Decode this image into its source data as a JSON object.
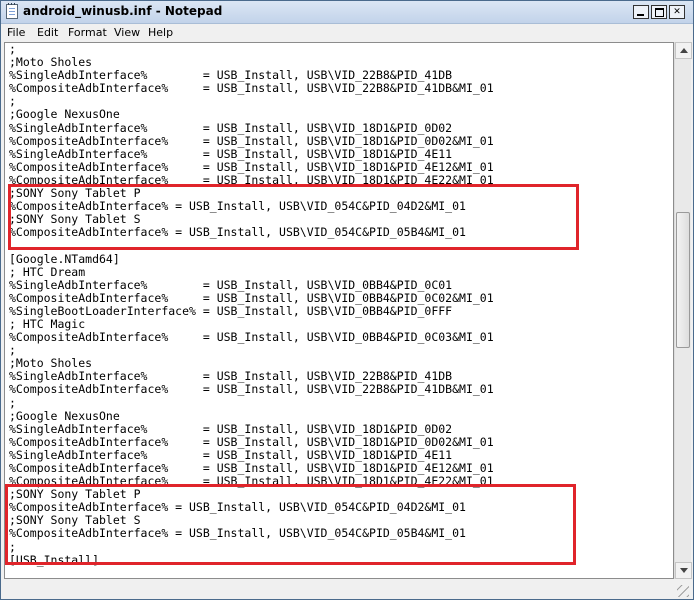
{
  "window": {
    "title": "android_winusb.inf - Notepad",
    "app_icon": "notepad-icon",
    "caption_buttons": [
      "minimize",
      "maximize",
      "close"
    ]
  },
  "menu": {
    "file": "File",
    "edit": "Edit",
    "format": "Format",
    "view": "View",
    "help": "Help"
  },
  "editor": {
    "lines": [
      ";",
      ";Moto Sholes",
      "%SingleAdbInterface%        = USB_Install, USB\\VID_22B8&PID_41DB",
      "%CompositeAdbInterface%     = USB_Install, USB\\VID_22B8&PID_41DB&MI_01",
      ";",
      ";Google NexusOne",
      "%SingleAdbInterface%        = USB_Install, USB\\VID_18D1&PID_0D02",
      "%CompositeAdbInterface%     = USB_Install, USB\\VID_18D1&PID_0D02&MI_01",
      "%SingleAdbInterface%        = USB_Install, USB\\VID_18D1&PID_4E11",
      "%CompositeAdbInterface%     = USB_Install, USB\\VID_18D1&PID_4E12&MI_01",
      "%CompositeAdbInterface%     = USB_Install, USB\\VID_18D1&PID_4E22&MI_01",
      ";SONY Sony Tablet P",
      "%CompositeAdbInterface% = USB_Install, USB\\VID_054C&PID_04D2&MI_01",
      ";SONY Sony Tablet S",
      "%CompositeAdbInterface% = USB_Install, USB\\VID_054C&PID_05B4&MI_01",
      "",
      "[Google.NTamd64]",
      "; HTC Dream",
      "%SingleAdbInterface%        = USB_Install, USB\\VID_0BB4&PID_0C01",
      "%CompositeAdbInterface%     = USB_Install, USB\\VID_0BB4&PID_0C02&MI_01",
      "%SingleBootLoaderInterface% = USB_Install, USB\\VID_0BB4&PID_0FFF",
      "; HTC Magic",
      "%CompositeAdbInterface%     = USB_Install, USB\\VID_0BB4&PID_0C03&MI_01",
      ";",
      ";Moto Sholes",
      "%SingleAdbInterface%        = USB_Install, USB\\VID_22B8&PID_41DB",
      "%CompositeAdbInterface%     = USB_Install, USB\\VID_22B8&PID_41DB&MI_01",
      ";",
      ";Google NexusOne",
      "%SingleAdbInterface%        = USB_Install, USB\\VID_18D1&PID_0D02",
      "%CompositeAdbInterface%     = USB_Install, USB\\VID_18D1&PID_0D02&MI_01",
      "%SingleAdbInterface%        = USB_Install, USB\\VID_18D1&PID_4E11",
      "%CompositeAdbInterface%     = USB_Install, USB\\VID_18D1&PID_4E12&MI_01",
      "%CompositeAdbInterface%     = USB_Install, USB\\VID_18D1&PID_4E22&MI_01",
      ";SONY Sony Tablet P",
      "%CompositeAdbInterface% = USB_Install, USB\\VID_054C&PID_04D2&MI_01",
      ";SONY Sony Tablet S",
      "%CompositeAdbInterface% = USB_Install, USB\\VID_054C&PID_05B4&MI_01",
      ";",
      "[USB_Install]"
    ]
  },
  "annotations": {
    "highlight_color": "#e0242a"
  }
}
